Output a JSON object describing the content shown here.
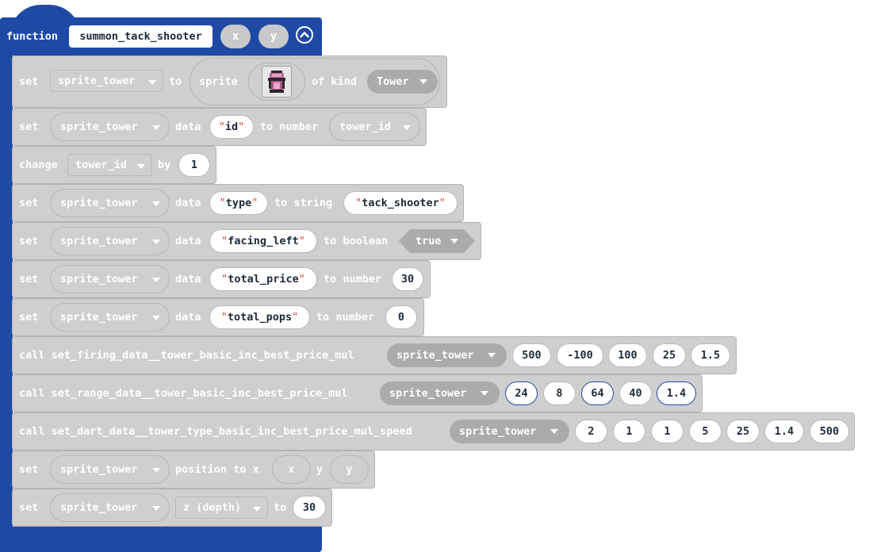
{
  "function_block": {
    "keyword": "function",
    "name": "summon_tack_shooter",
    "params": [
      "x",
      "y"
    ],
    "collapse_icon": "chevron-up-circle-icon",
    "color": "#1e4aa5"
  },
  "statements": [
    {
      "kw1": "set",
      "var": "sprite_tower",
      "kw2": "to",
      "kw3": "sprite",
      "image_icon": "tack-shooter-sprite-icon",
      "kw4": "of kind",
      "kind": "Tower"
    },
    {
      "kw1": "set",
      "var": "sprite_tower",
      "kw2": "data",
      "key": "id",
      "kw3": "to number",
      "value": "tower_id"
    },
    {
      "kw1": "change",
      "var": "tower_id",
      "kw2": "by",
      "value": "1"
    },
    {
      "kw1": "set",
      "var": "sprite_tower",
      "kw2": "data",
      "key": "type",
      "kw3": "to string",
      "value": "tack_shooter"
    },
    {
      "kw1": "set",
      "var": "sprite_tower",
      "kw2": "data",
      "key": "facing_left",
      "kw3": "to boolean",
      "value": "true"
    },
    {
      "kw1": "set",
      "var": "sprite_tower",
      "kw2": "data",
      "key": "total_price",
      "kw3": "to number",
      "value": "30"
    },
    {
      "kw1": "set",
      "var": "sprite_tower",
      "kw2": "data",
      "key": "total_pops",
      "kw3": "to number",
      "value": "0"
    },
    {
      "kw1": "call set_firing_data__tower_basic_inc_best_price_mul",
      "var": "sprite_tower",
      "args": [
        "500",
        "-100",
        "100",
        "25",
        "1.5"
      ]
    },
    {
      "kw1": "call set_range_data__tower_basic_inc_best_price_mul",
      "var": "sprite_tower",
      "args": [
        "24",
        "8",
        "64",
        "40",
        "1.4"
      ]
    },
    {
      "kw1": "call set_dart_data__tower_type_basic_inc_best_price_mul_speed",
      "var": "sprite_tower",
      "args": [
        "2",
        "1",
        "1",
        "5",
        "25",
        "1.4",
        "500"
      ]
    },
    {
      "kw1": "set",
      "var": "sprite_tower",
      "kw2": "position to x",
      "x": "x",
      "kw3": "y",
      "y": "y"
    },
    {
      "kw1": "set",
      "var": "sprite_tower",
      "prop": "z (depth)",
      "kw2": "to",
      "value": "30"
    }
  ],
  "colors": {
    "block": "#cfcfcf",
    "function": "#1e4aa5",
    "string_quote": "#e0453a"
  }
}
